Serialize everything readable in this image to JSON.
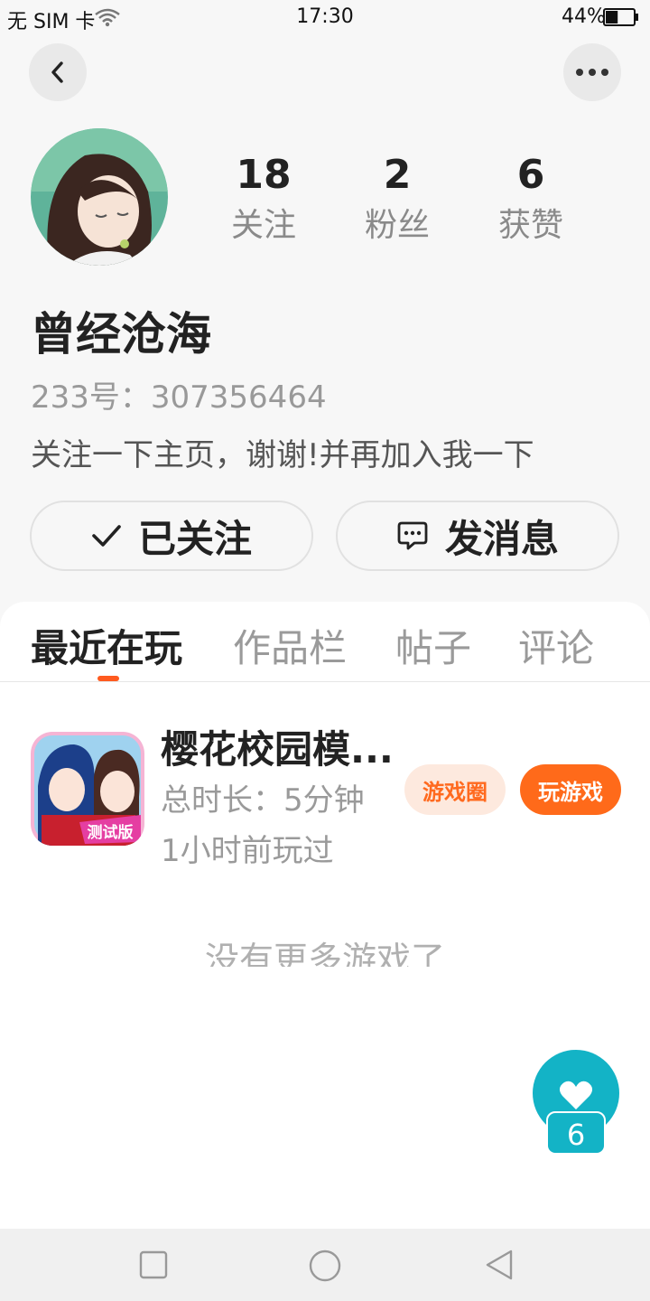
{
  "status_bar": {
    "carrier": "无 SIM 卡",
    "time": "17:30",
    "battery_pct": "44%",
    "battery_level": 0.44,
    "icons": [
      "wifi-icon",
      "battery-icon"
    ]
  },
  "nav": {
    "back_icon": "chevron-left-icon",
    "more_icon": "more-dots-icon"
  },
  "profile": {
    "stats": [
      {
        "value": "18",
        "label": "关注"
      },
      {
        "value": "2",
        "label": "粉丝"
      },
      {
        "value": "6",
        "label": "获赞"
      }
    ],
    "name": "曾经沧海",
    "id_text": "233号：307356464",
    "bio": "关注一下主页，谢谢!并再加入我一下"
  },
  "actions": {
    "follow_label": "已关注",
    "follow_icon": "check-icon",
    "message_label": "发消息",
    "message_icon": "chat-bubble-icon"
  },
  "tabs": [
    {
      "label": "最近在玩",
      "active": true
    },
    {
      "label": "作品栏",
      "active": false
    },
    {
      "label": "帖子",
      "active": false
    },
    {
      "label": "评论",
      "active": false
    }
  ],
  "games": [
    {
      "name": "樱花校园模...",
      "icon_badge": "测试版",
      "duration": "总时长：5分钟",
      "last_played": "1小时前玩过",
      "circle_label": "游戏圈",
      "play_label": "玩游戏"
    }
  ],
  "no_more_text": "没有更多游戏了",
  "like": {
    "count": "6",
    "icon": "heart-icon"
  },
  "colors": {
    "accent": "#ff6a1a",
    "like": "#13b3c6",
    "tag_bg": "#fde9de"
  }
}
